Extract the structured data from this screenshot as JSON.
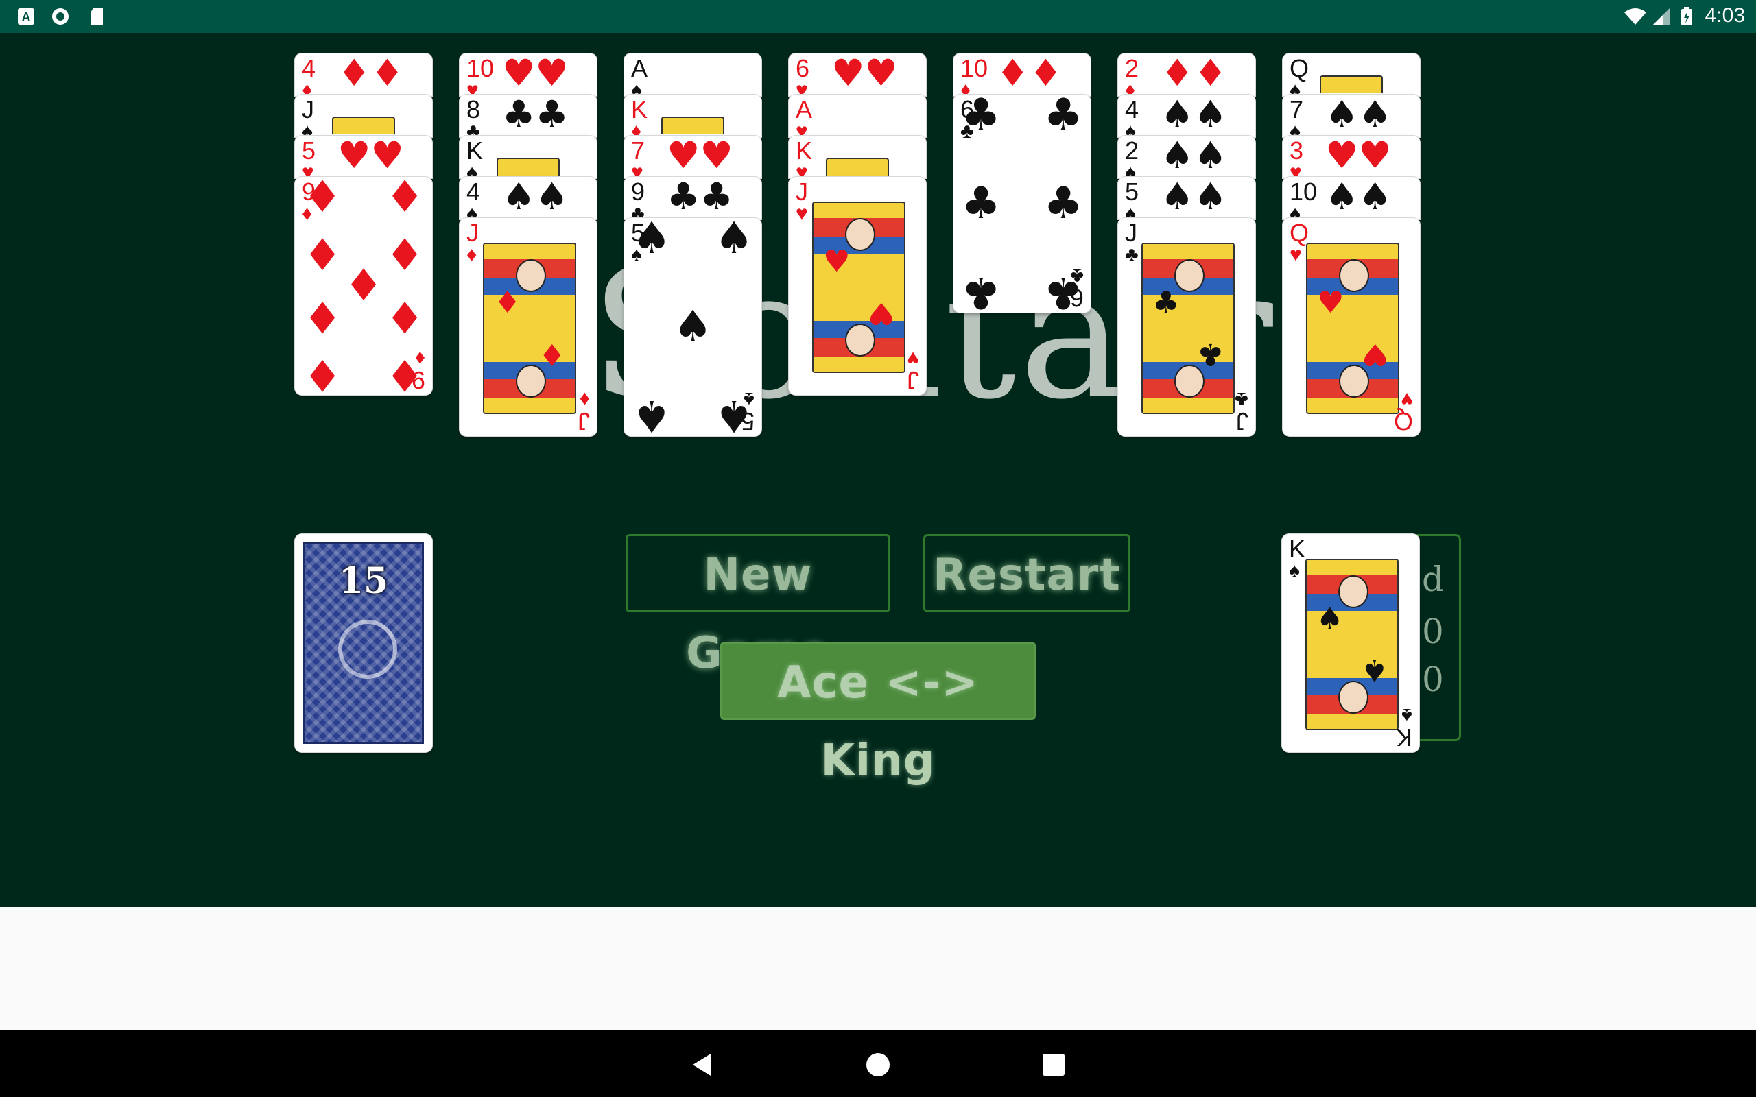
{
  "status_bar": {
    "time": "4:03",
    "left_icons": [
      "a-notification-icon",
      "circle-notification-icon",
      "sd-card-icon"
    ],
    "right_icons": [
      "wifi-icon",
      "signal-icon",
      "battery-charging-icon"
    ]
  },
  "game": {
    "title_watermark": "Solitaire",
    "stock_count": "15",
    "buttons": {
      "new_game": "New Game",
      "restart": "Restart",
      "ace_king": "Ace <-> King"
    },
    "score_panel": {
      "line1": "d",
      "line2": "0",
      "line3": "0"
    }
  },
  "tableau": [
    {
      "cards": [
        {
          "rank": "4",
          "suit": "♦",
          "color": "red"
        },
        {
          "rank": "J",
          "suit": "♠",
          "color": "black"
        },
        {
          "rank": "5",
          "suit": "♥",
          "color": "red"
        },
        {
          "rank": "9",
          "suit": "♦",
          "color": "red"
        }
      ]
    },
    {
      "cards": [
        {
          "rank": "10",
          "suit": "♥",
          "color": "red"
        },
        {
          "rank": "8",
          "suit": "♣",
          "color": "black"
        },
        {
          "rank": "K",
          "suit": "♠",
          "color": "black"
        },
        {
          "rank": "4",
          "suit": "♠",
          "color": "black"
        },
        {
          "rank": "J",
          "suit": "♦",
          "color": "red"
        }
      ]
    },
    {
      "cards": [
        {
          "rank": "A",
          "suit": "♠",
          "color": "black"
        },
        {
          "rank": "K",
          "suit": "♦",
          "color": "red"
        },
        {
          "rank": "7",
          "suit": "♥",
          "color": "red"
        },
        {
          "rank": "9",
          "suit": "♣",
          "color": "black"
        },
        {
          "rank": "5",
          "suit": "♠",
          "color": "black"
        }
      ]
    },
    {
      "cards": [
        {
          "rank": "6",
          "suit": "♥",
          "color": "red"
        },
        {
          "rank": "A",
          "suit": "♥",
          "color": "red"
        },
        {
          "rank": "K",
          "suit": "♥",
          "color": "red"
        },
        {
          "rank": "J",
          "suit": "♥",
          "color": "red"
        }
      ]
    },
    {
      "cards": [
        {
          "rank": "10",
          "suit": "♦",
          "color": "red"
        },
        {
          "rank": "6",
          "suit": "♣",
          "color": "black"
        }
      ]
    },
    {
      "cards": [
        {
          "rank": "2",
          "suit": "♦",
          "color": "red"
        },
        {
          "rank": "4",
          "suit": "♠",
          "color": "black"
        },
        {
          "rank": "2",
          "suit": "♠",
          "color": "black"
        },
        {
          "rank": "5",
          "suit": "♠",
          "color": "black"
        },
        {
          "rank": "J",
          "suit": "♣",
          "color": "black"
        }
      ]
    },
    {
      "cards": [
        {
          "rank": "Q",
          "suit": "♠",
          "color": "black"
        },
        {
          "rank": "7",
          "suit": "♠",
          "color": "black"
        },
        {
          "rank": "3",
          "suit": "♥",
          "color": "red"
        },
        {
          "rank": "10",
          "suit": "♠",
          "color": "black"
        },
        {
          "rank": "Q",
          "suit": "♥",
          "color": "red"
        }
      ]
    }
  ],
  "waste_card": {
    "rank": "K",
    "suit": "♠",
    "color": "black"
  },
  "colors": {
    "felt": "#00281a",
    "status_bar": "#005444",
    "button_border": "#2d7a2d",
    "button_active": "#4d8b3d",
    "red_suit": "#e8141e"
  }
}
